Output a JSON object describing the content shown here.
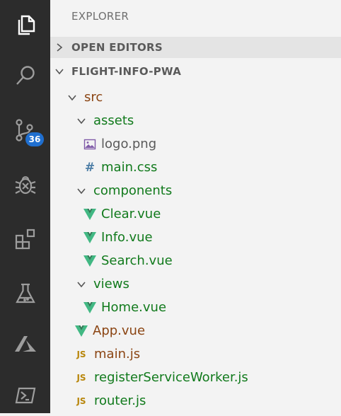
{
  "activity_bar": {
    "items": [
      {
        "icon": "files-icon"
      },
      {
        "icon": "search-icon"
      },
      {
        "icon": "source-control-icon"
      },
      {
        "icon": "debug-icon"
      },
      {
        "icon": "extensions-icon"
      },
      {
        "icon": "testing-flask-icon"
      },
      {
        "icon": "azure-icon"
      },
      {
        "icon": "terminal-icon"
      }
    ],
    "source_control_badge": "36"
  },
  "explorer": {
    "title": "EXPLORER",
    "sections": {
      "open_editors": "OPEN EDITORS",
      "project": "FLIGHT-INFO-PWA"
    },
    "tree": [
      {
        "name": "src",
        "type": "folder",
        "expanded": true
      },
      {
        "name": "assets",
        "type": "folder",
        "expanded": true
      },
      {
        "name": "logo.png",
        "type": "image"
      },
      {
        "name": "main.css",
        "type": "css"
      },
      {
        "name": "components",
        "type": "folder",
        "expanded": true
      },
      {
        "name": "Clear.vue",
        "type": "vue"
      },
      {
        "name": "Info.vue",
        "type": "vue"
      },
      {
        "name": "Search.vue",
        "type": "vue"
      },
      {
        "name": "views",
        "type": "folder",
        "expanded": true
      },
      {
        "name": "Home.vue",
        "type": "vue"
      },
      {
        "name": "App.vue",
        "type": "vue"
      },
      {
        "name": "main.js",
        "type": "js"
      },
      {
        "name": "registerServiceWorker.js",
        "type": "js"
      },
      {
        "name": "router.js",
        "type": "js"
      }
    ]
  },
  "colors": {
    "activity_bg": "#2c2c2c",
    "sidebar_bg": "#f3f3f3",
    "modified_folder": "#8b4513",
    "untracked_file": "#117a1c",
    "vue_icon": "#41b883",
    "badge": "#1f6fd0"
  }
}
